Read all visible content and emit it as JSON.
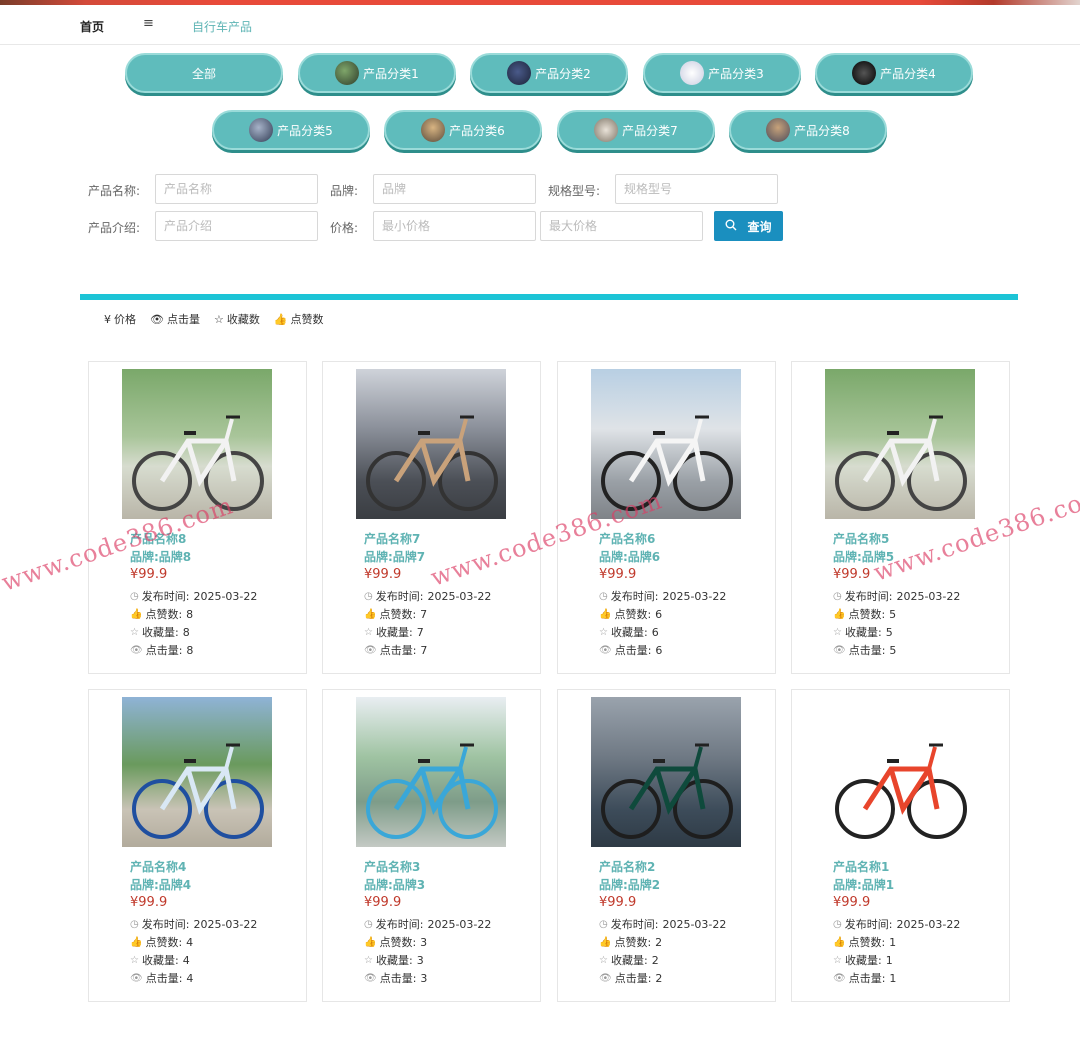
{
  "nav": {
    "home": "首页",
    "menu_icon": "menu-icon",
    "breadcrumb": "自行车产品"
  },
  "categories": [
    {
      "label": "全部"
    },
    {
      "label": "产品分类1"
    },
    {
      "label": "产品分类2"
    },
    {
      "label": "产品分类3"
    },
    {
      "label": "产品分类4"
    },
    {
      "label": "产品分类5"
    },
    {
      "label": "产品分类6"
    },
    {
      "label": "产品分类7"
    },
    {
      "label": "产品分类8"
    }
  ],
  "search": {
    "name_label": "产品名称:",
    "name_placeholder": "产品名称",
    "brand_label": "品牌:",
    "brand_placeholder": "品牌",
    "spec_label": "规格型号:",
    "spec_placeholder": "规格型号",
    "intro_label": "产品介绍:",
    "intro_placeholder": "产品介绍",
    "price_label": "价格:",
    "min_price_placeholder": "最小价格",
    "max_price_placeholder": "最大价格",
    "button": "查询"
  },
  "sort": {
    "price": "价格",
    "clicks": "点击量",
    "favorites": "收藏数",
    "likes": "点赞数"
  },
  "labels": {
    "publish": "发布时间:",
    "likes": "点赞数:",
    "favorites": "收藏量:",
    "clicks": "点击量:"
  },
  "products": [
    {
      "name": "产品名称8",
      "brand": "品牌:品牌8",
      "price": "¥99.9",
      "date": "2025-03-22",
      "likes": "8",
      "favorites": "8",
      "clicks": "8"
    },
    {
      "name": "产品名称7",
      "brand": "品牌:品牌7",
      "price": "¥99.9",
      "date": "2025-03-22",
      "likes": "7",
      "favorites": "7",
      "clicks": "7"
    },
    {
      "name": "产品名称6",
      "brand": "品牌:品牌6",
      "price": "¥99.9",
      "date": "2025-03-22",
      "likes": "6",
      "favorites": "6",
      "clicks": "6"
    },
    {
      "name": "产品名称5",
      "brand": "品牌:品牌5",
      "price": "¥99.9",
      "date": "2025-03-22",
      "likes": "5",
      "favorites": "5",
      "clicks": "5"
    },
    {
      "name": "产品名称4",
      "brand": "品牌:品牌4",
      "price": "¥99.9",
      "date": "2025-03-22",
      "likes": "4",
      "favorites": "4",
      "clicks": "4"
    },
    {
      "name": "产品名称3",
      "brand": "品牌:品牌3",
      "price": "¥99.9",
      "date": "2025-03-22",
      "likes": "3",
      "favorites": "3",
      "clicks": "3"
    },
    {
      "name": "产品名称2",
      "brand": "品牌:品牌2",
      "price": "¥99.9",
      "date": "2025-03-22",
      "likes": "2",
      "favorites": "2",
      "clicks": "2"
    },
    {
      "name": "产品名称1",
      "brand": "品牌:品牌1",
      "price": "¥99.9",
      "date": "2025-03-22",
      "likes": "1",
      "favorites": "1",
      "clicks": "1"
    }
  ],
  "watermark": "www.code386.com",
  "colors": {
    "accent": "#5fbcbc",
    "divider": "#1cc4d6",
    "search_button": "#1a8fbf",
    "price": "#c0392b",
    "title": "#5fb3b3"
  }
}
